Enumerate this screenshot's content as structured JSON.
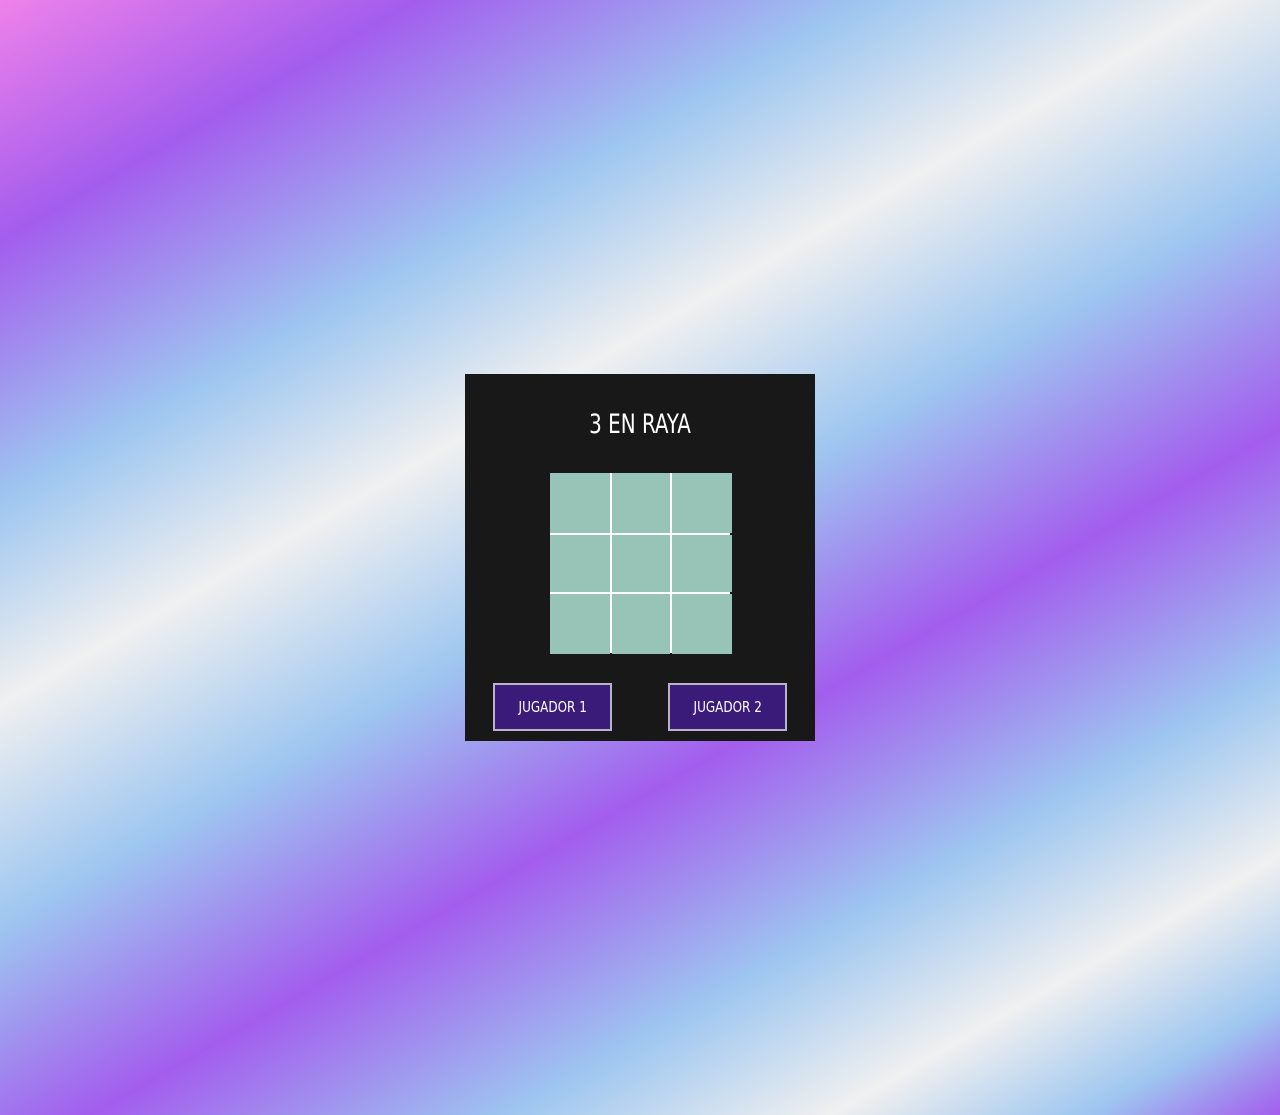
{
  "game": {
    "title": "3 EN RAYA",
    "board": [
      [
        "",
        "",
        ""
      ],
      [
        "",
        "",
        ""
      ],
      [
        "",
        "",
        ""
      ]
    ]
  },
  "players": {
    "player1_label": "JUGADOR 1",
    "player2_label": "JUGADOR 2"
  },
  "colors": {
    "panel": "#181818",
    "cell": "#98c4b8",
    "button": "#3b1b79",
    "grid_lines": "#ffffff"
  }
}
